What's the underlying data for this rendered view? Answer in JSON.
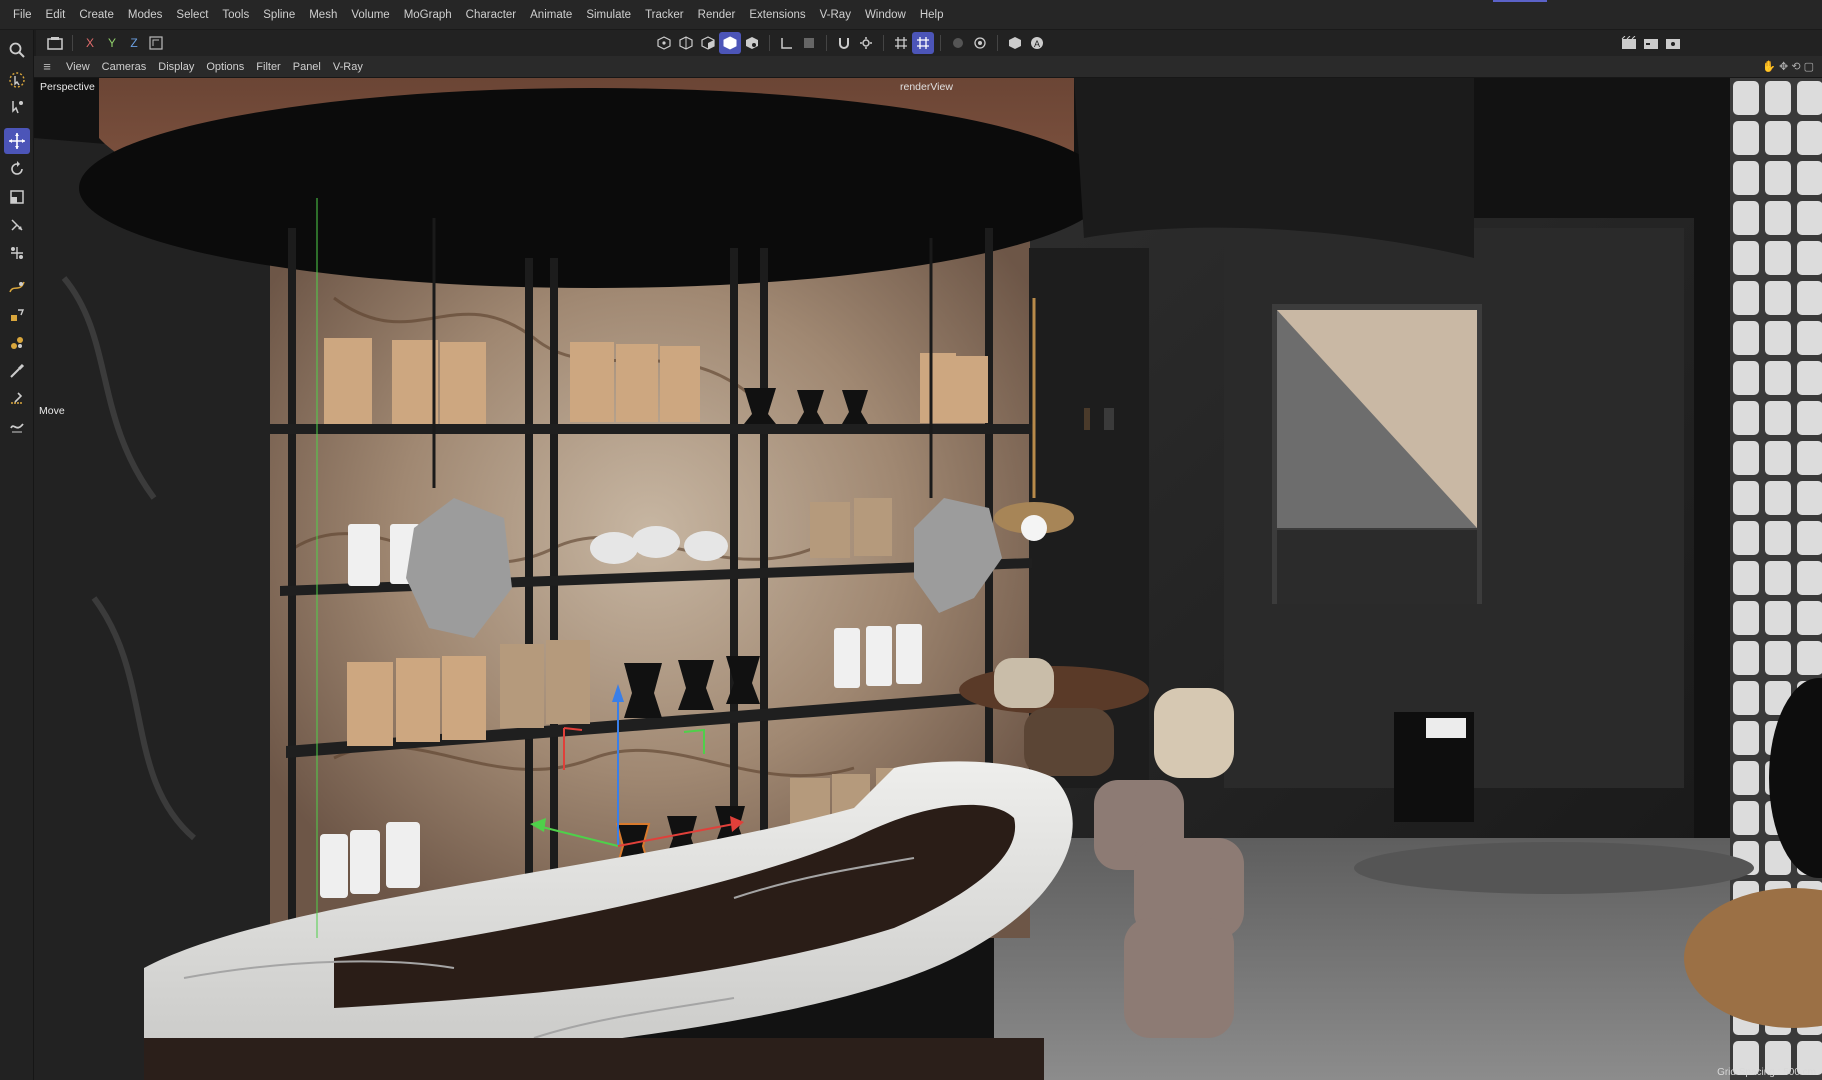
{
  "menubar": {
    "items": [
      "File",
      "Edit",
      "Create",
      "Modes",
      "Select",
      "Tools",
      "Spline",
      "Mesh",
      "Volume",
      "MoGraph",
      "Character",
      "Animate",
      "Simulate",
      "Tracker",
      "Render",
      "Extensions",
      "V-Ray",
      "Window",
      "Help"
    ]
  },
  "toolbar": {
    "axis_x": "X",
    "axis_y": "Y",
    "axis_z": "Z"
  },
  "viewport_menu": {
    "items": [
      "View",
      "Cameras",
      "Display",
      "Options",
      "Filter",
      "Panel",
      "V-Ray"
    ]
  },
  "viewport": {
    "camera_label": "Perspective",
    "view_title": "renderView",
    "tool_hud": "Move",
    "grid_spacing": "Grid Spacing : 500 cm"
  },
  "colors": {
    "accent": "#4c55b8",
    "x_axis": "#e0403a",
    "y_axis": "#4fd04a",
    "z_axis": "#3a7fe8"
  }
}
